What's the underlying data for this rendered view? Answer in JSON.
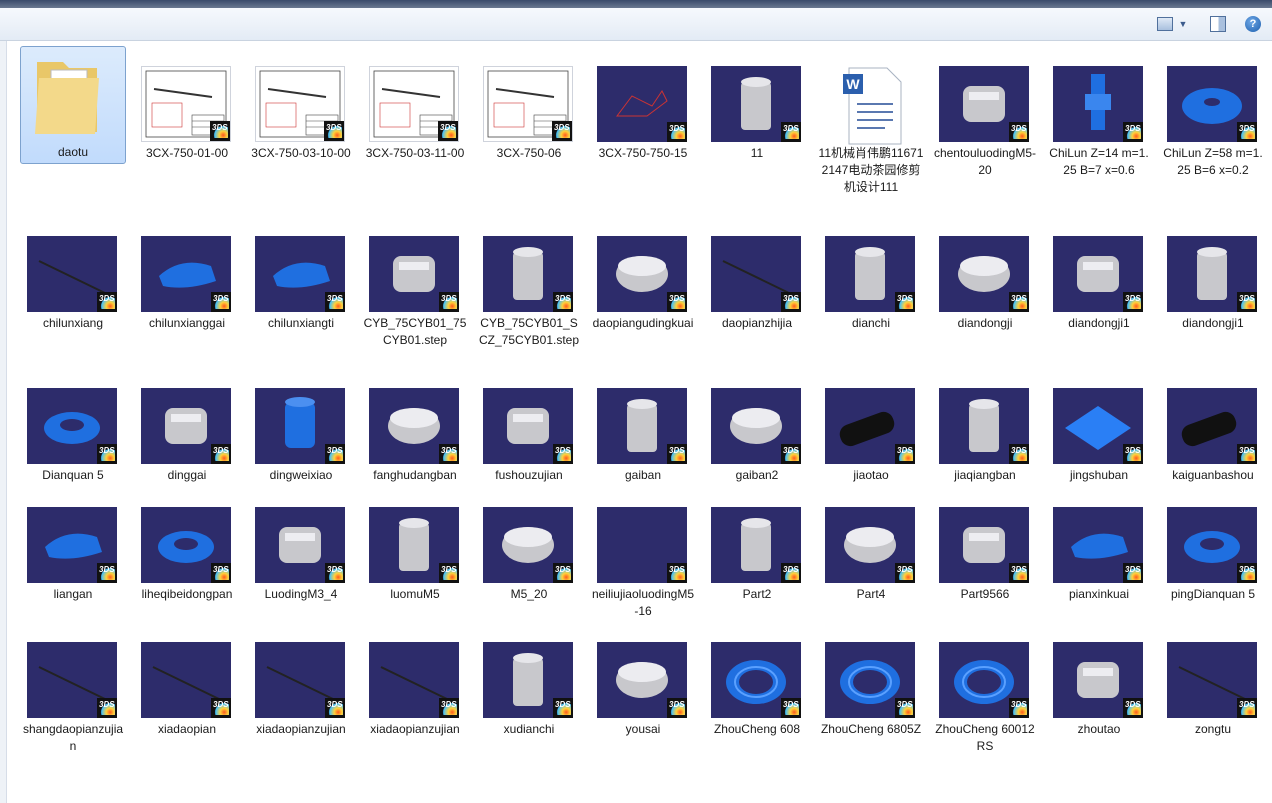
{
  "toolbar": {
    "views_icon": "views-icon",
    "preview_pane_icon": "preview-pane-icon",
    "help_label": "?"
  },
  "items": [
    {
      "label": "daotu",
      "type": "folder"
    },
    {
      "label": "3CX-750-01-00",
      "type": "drawing"
    },
    {
      "label": "3CX-750-03-10-00",
      "type": "drawing"
    },
    {
      "label": "3CX-750-03-11-00",
      "type": "drawing"
    },
    {
      "label": "3CX-750-06",
      "type": "drawing"
    },
    {
      "label": "3CX-750-750-15",
      "type": "cad"
    },
    {
      "label": "11",
      "type": "cad"
    },
    {
      "label": "11机械肖伟鹏116712147电动茶园修剪机设计111",
      "type": "word"
    },
    {
      "label": "chentouluodingM5-20",
      "type": "cad"
    },
    {
      "label": "ChiLun Z=14 m=1.25 B=7 x=0.6",
      "type": "cad"
    },
    {
      "label": "ChiLun Z=58 m=1.25 B=6 x=0.2",
      "type": "cad"
    },
    {
      "label": "chilunxiang",
      "type": "cad"
    },
    {
      "label": "chilunxianggai",
      "type": "cad"
    },
    {
      "label": "chilunxiangti",
      "type": "cad"
    },
    {
      "label": "CYB_75CYB01_75CYB01.step",
      "type": "cad"
    },
    {
      "label": "CYB_75CYB01_SCZ_75CYB01.step",
      "type": "cad"
    },
    {
      "label": "daopiangudingkuai",
      "type": "cad"
    },
    {
      "label": "daopianzhijia",
      "type": "cad"
    },
    {
      "label": "dianchi",
      "type": "cad"
    },
    {
      "label": "diandongji",
      "type": "cad"
    },
    {
      "label": "diandongji1",
      "type": "cad"
    },
    {
      "label": "diandongji1",
      "type": "cad"
    },
    {
      "label": "Dianquan 5",
      "type": "cad"
    },
    {
      "label": "dinggai",
      "type": "cad"
    },
    {
      "label": "dingweixiao",
      "type": "cad"
    },
    {
      "label": "fanghudangban",
      "type": "cad"
    },
    {
      "label": "fushouzujian",
      "type": "cad"
    },
    {
      "label": "gaiban",
      "type": "cad"
    },
    {
      "label": "gaiban2",
      "type": "cad"
    },
    {
      "label": "jiaotao",
      "type": "cad"
    },
    {
      "label": "jiaqiangban",
      "type": "cad"
    },
    {
      "label": "jingshuban",
      "type": "cad"
    },
    {
      "label": "kaiguanbashou",
      "type": "cad"
    },
    {
      "label": "liangan",
      "type": "cad"
    },
    {
      "label": "liheqibeidongpan",
      "type": "cad"
    },
    {
      "label": "LuodingM3_4",
      "type": "cad"
    },
    {
      "label": "luomuM5",
      "type": "cad"
    },
    {
      "label": "M5_20",
      "type": "cad"
    },
    {
      "label": "neiliujiaoluodingM5-16",
      "type": "cad"
    },
    {
      "label": "Part2",
      "type": "cad"
    },
    {
      "label": "Part4",
      "type": "cad"
    },
    {
      "label": "Part9566",
      "type": "cad"
    },
    {
      "label": "pianxinkuai",
      "type": "cad"
    },
    {
      "label": "pingDianquan 5",
      "type": "cad"
    },
    {
      "label": "shangdaopianzujian",
      "type": "cad"
    },
    {
      "label": "xiadaopian",
      "type": "cad"
    },
    {
      "label": "xiadaopianzujian",
      "type": "cad"
    },
    {
      "label": "xiadaopianzujian",
      "type": "cad"
    },
    {
      "label": "xudianchi",
      "type": "cad"
    },
    {
      "label": "yousai",
      "type": "cad"
    },
    {
      "label": "ZhouCheng 608",
      "type": "cad"
    },
    {
      "label": "ZhouCheng 6805Z",
      "type": "cad"
    },
    {
      "label": "ZhouCheng 60012RS",
      "type": "cad"
    },
    {
      "label": "zhoutao",
      "type": "cad"
    },
    {
      "label": "zongtu",
      "type": "cad"
    }
  ]
}
